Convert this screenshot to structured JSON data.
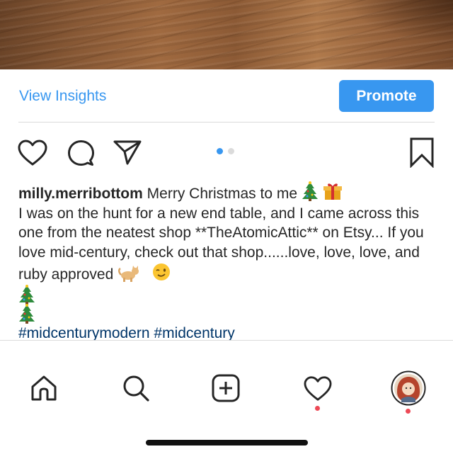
{
  "post": {
    "image_icon": "wood-floor-photo",
    "view_insights": "View Insights",
    "promote": "Promote",
    "carousel": {
      "count": 2,
      "active_index": 0,
      "active_color": "#3897f0",
      "inactive_color": "#dbdbdb"
    },
    "actions": [
      "heart-icon",
      "comment-icon",
      "share-icon",
      "bookmark-icon"
    ],
    "username": "milly.merribottom",
    "caption_first_line": "Merry Christmas to me",
    "caption_body": "I was on the hunt for a new end table, and I came across this one from the neatest shop **TheAtomicAttic** on Etsy... If you love mid-century, check out that shop......love, love, love, and ruby approved",
    "emojis": [
      "christmas-tree-emoji",
      "gift-emoji",
      "cat-emoji",
      "wink-emoji"
    ],
    "hashtags": "#midcenturymodern #midcentury"
  },
  "tabbar": {
    "items": [
      "home-icon",
      "search-icon",
      "new-post-icon",
      "activity-icon",
      "profile-avatar"
    ],
    "notification_color": "#ed4956"
  },
  "colors": {
    "link": "#3897f0",
    "hashtag": "#003569",
    "text": "#262626"
  }
}
